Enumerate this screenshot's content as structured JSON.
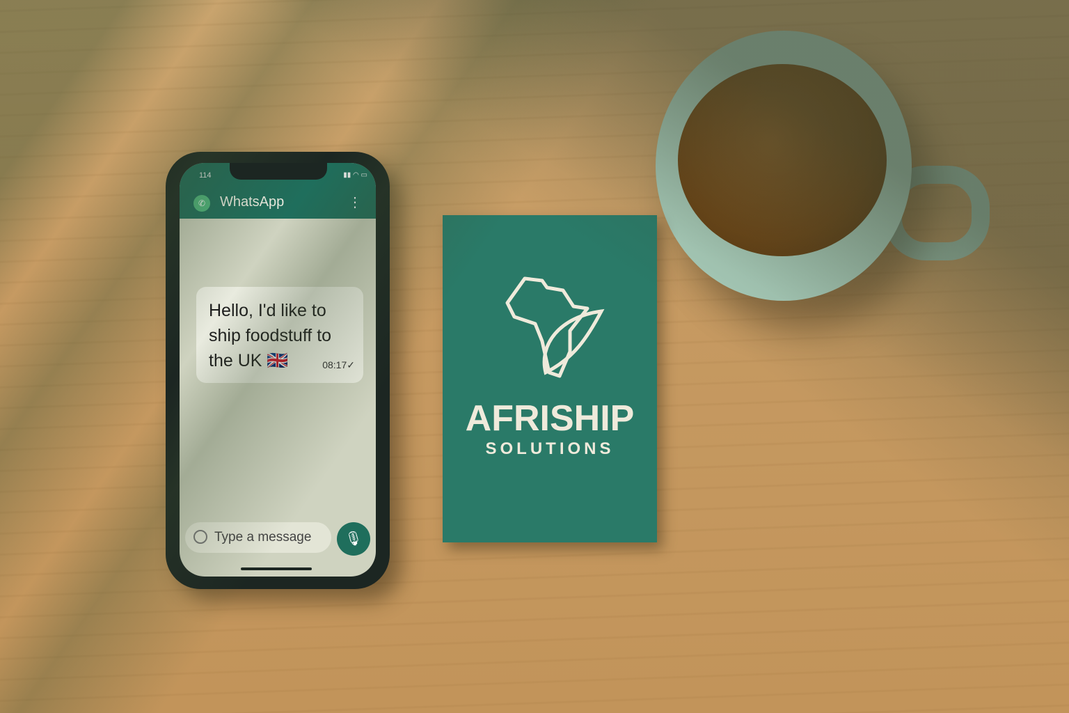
{
  "phone": {
    "status_time": "114",
    "app_title": "WhatsApp",
    "message": {
      "text": "Hello, I'd like to ship foodstuff to the UK 🇬🇧",
      "time": "08:17"
    },
    "input_placeholder": "Type a message",
    "colors": {
      "header": "#1f6e5c",
      "accent": "#4fb97f"
    }
  },
  "card": {
    "brand": "AFRISHIP",
    "subtitle": "SOLUTIONS",
    "color": "#2a7a68"
  }
}
